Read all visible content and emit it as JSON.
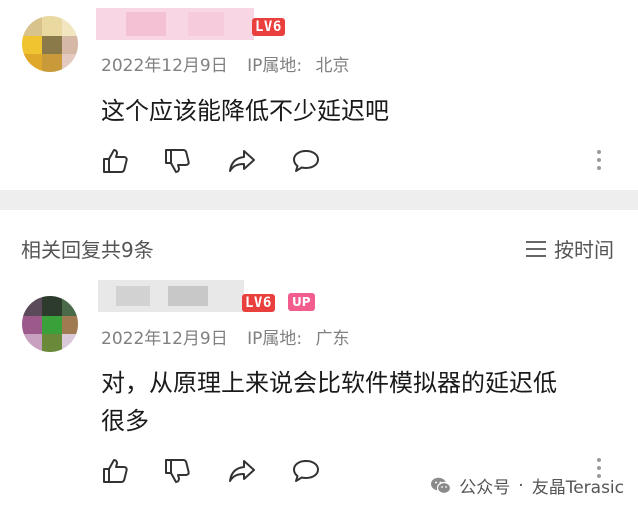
{
  "comments": [
    {
      "level": "LV6",
      "date": "2022年12月9日",
      "ip_label": "IP属地:",
      "ip_location": "北京",
      "text": "这个应该能降低不少延迟吧"
    },
    {
      "level": "LV6",
      "badge": "UP",
      "date": "2022年12月9日",
      "ip_label": "IP属地:",
      "ip_location": "广东",
      "text_line1": "对，从原理上来说会比软件模拟器的延迟低",
      "text_line2": "很多"
    }
  ],
  "replies": {
    "title": "相关回复共9条",
    "sort_label": "按时间"
  },
  "watermark": {
    "account": "公众号",
    "separator": "·",
    "name": "友晶Terasic"
  },
  "icons": [
    "thumbs-up-icon",
    "thumbs-down-icon",
    "share-icon",
    "comment-icon",
    "more-vertical-icon",
    "sort-menu-icon",
    "wechat-icon"
  ],
  "colors": {
    "level_badge": "#e9403e",
    "up_badge": "#f25d8e",
    "meta_text": "#808080",
    "separator": "#eeeeee"
  }
}
